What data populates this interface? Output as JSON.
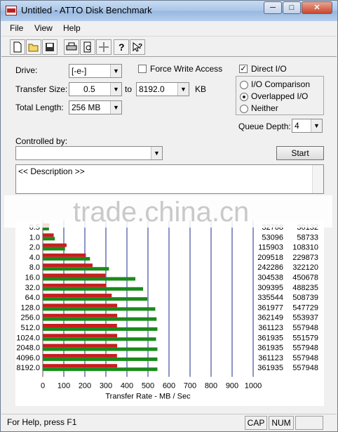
{
  "window": {
    "title": "Untitled - ATTO Disk Benchmark",
    "minimize": "─",
    "maximize": "□",
    "close": "✕"
  },
  "menu": [
    "File",
    "View",
    "Help"
  ],
  "toolbar": [
    "new-icon",
    "open-icon",
    "save-icon",
    "print-icon",
    "print-preview-icon",
    "move-icon",
    "help-icon",
    "context-help-icon"
  ],
  "form": {
    "drive_label": "Drive:",
    "drive_value": "[-e-]",
    "force_write_label": "Force Write Access",
    "force_write_checked": false,
    "direct_io_label": "Direct I/O",
    "direct_io_checked": true,
    "transfer_size_label": "Transfer Size:",
    "transfer_from": "0.5",
    "to_label": "to",
    "transfer_to": "8192.0",
    "kb_label": "KB",
    "total_length_label": "Total Length:",
    "total_length_value": "256 MB",
    "io_options": [
      "I/O Comparison",
      "Overlapped I/O",
      "Neither"
    ],
    "io_selected": "Overlapped I/O",
    "queue_depth_label": "Queue Depth:",
    "queue_depth_value": "4",
    "controlled_by_label": "Controlled by:",
    "controlled_by_value": "",
    "start_label": "Start",
    "description": "<< Description >>"
  },
  "watermark": "trade.china.cn",
  "chart_data": {
    "type": "bar",
    "orientation": "horizontal",
    "categories": [
      "0.5",
      "1.0",
      "2.0",
      "4.0",
      "8.0",
      "16.0",
      "32.0",
      "64.0",
      "128.0",
      "256.0",
      "512.0",
      "1024.0",
      "2048.0",
      "4096.0",
      "8192.0"
    ],
    "series": [
      {
        "color": "#c81e1e",
        "values": [
          32768,
          53096,
          115903,
          209518,
          242286,
          304538,
          309395,
          335544,
          361977,
          362149,
          361123,
          361935,
          361935,
          361123,
          361935
        ]
      },
      {
        "color": "#1a8a1a",
        "values": [
          30132,
          58733,
          108310,
          229873,
          322120,
          450678,
          488235,
          508739,
          547729,
          553937,
          557948,
          551579,
          557948,
          557948,
          557948
        ]
      }
    ],
    "x_ticks": [
      0,
      100,
      200,
      300,
      400,
      500,
      600,
      700,
      800,
      900,
      1000
    ],
    "xlim": [
      0,
      1000
    ],
    "xlabel": "Transfer Rate - MB / Sec",
    "grid": true
  },
  "status": {
    "text": "For Help, press F1",
    "cap": "CAP",
    "num": "NUM"
  }
}
